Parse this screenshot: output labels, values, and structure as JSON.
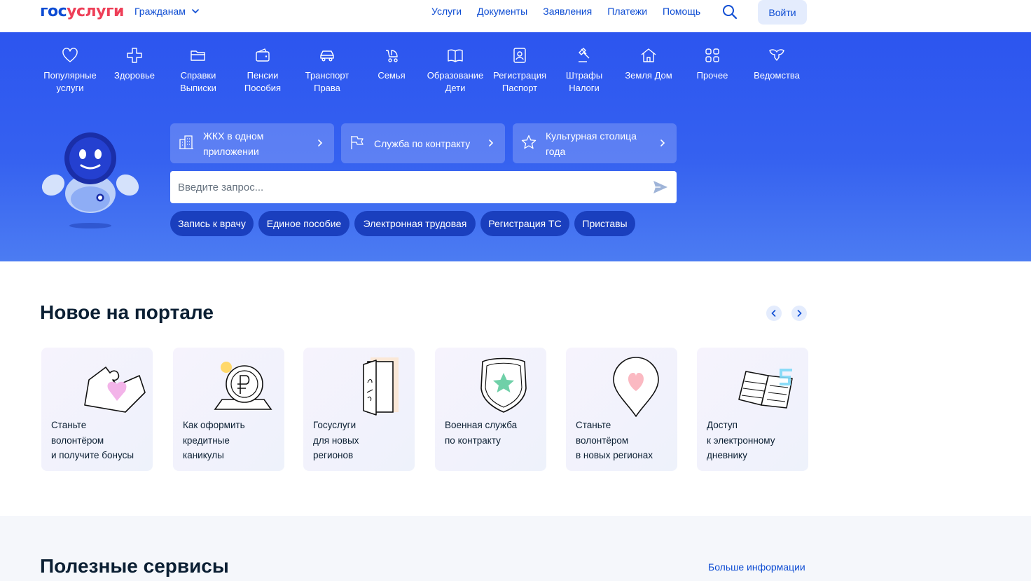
{
  "header": {
    "logo": {
      "part1": "гос",
      "part2": "услуги"
    },
    "audience": "Гражданам",
    "nav": [
      "Услуги",
      "Документы",
      "Заявления",
      "Платежи",
      "Помощь"
    ],
    "login": "Войти"
  },
  "categories": [
    {
      "icon": "heart-icon",
      "line1": "Популярные",
      "line2": "услуги"
    },
    {
      "icon": "health-cross-icon",
      "line1": "Здоровье",
      "line2": ""
    },
    {
      "icon": "folder-icon",
      "line1": "Справки",
      "line2": "Выписки"
    },
    {
      "icon": "wallet-icon",
      "line1": "Пенсии",
      "line2": "Пособия"
    },
    {
      "icon": "car-icon",
      "line1": "Транспорт",
      "line2": "Права"
    },
    {
      "icon": "stroller-icon",
      "line1": "Семья",
      "line2": ""
    },
    {
      "icon": "book-icon",
      "line1": "Образование",
      "line2": "Дети"
    },
    {
      "icon": "id-card-icon",
      "line1": "Регистрация",
      "line2": "Паспорт"
    },
    {
      "icon": "gavel-icon",
      "line1": "Штрафы",
      "line2": "Налоги"
    },
    {
      "icon": "house-icon",
      "line1": "Земля Дом",
      "line2": ""
    },
    {
      "icon": "grid-icon",
      "line1": "Прочее",
      "line2": ""
    },
    {
      "icon": "emblem-icon",
      "line1": "Ведомства",
      "line2": ""
    }
  ],
  "promos": [
    {
      "icon": "building-icon",
      "line1": "ЖКХ в одном",
      "line2": "приложении"
    },
    {
      "icon": "flag-icon",
      "line1": "Служба по контракту",
      "line2": ""
    },
    {
      "icon": "star-icon",
      "line1": "Культурная столица",
      "line2": "года"
    }
  ],
  "search": {
    "placeholder": "Введите запрос..."
  },
  "chips": [
    "Запись к врачу",
    "Единое пособие",
    "Электронная трудовая",
    "Регистрация ТС",
    "Приставы"
  ],
  "news": {
    "title": "Новое на портале",
    "cards": [
      {
        "art": "puzzle-heart-illustration",
        "lines": [
          "Станьте",
          "волонтёром",
          "и получите бонусы"
        ]
      },
      {
        "art": "ruble-coin-illustration",
        "lines": [
          "Как оформить",
          "кредитные",
          "каникулы"
        ]
      },
      {
        "art": "open-door-illustration",
        "lines": [
          "Госуслуги",
          "для новых",
          "регионов"
        ]
      },
      {
        "art": "shield-star-illustration",
        "lines": [
          "Военная служба",
          "по контракту",
          ""
        ]
      },
      {
        "art": "map-pin-heart-illustration",
        "lines": [
          "Станьте",
          "волонтёром",
          "в новых регионах"
        ]
      },
      {
        "art": "diary-illustration",
        "lines": [
          "Доступ",
          "к электронному",
          "дневнику"
        ]
      }
    ]
  },
  "services": {
    "title": "Полезные сервисы",
    "more": "Больше информации"
  },
  "colors": {
    "brand_blue": "#0d4cd3",
    "brand_red": "#ee3f58",
    "hero_blue": "#3561f0",
    "chip_blue": "#1a3fbe"
  }
}
